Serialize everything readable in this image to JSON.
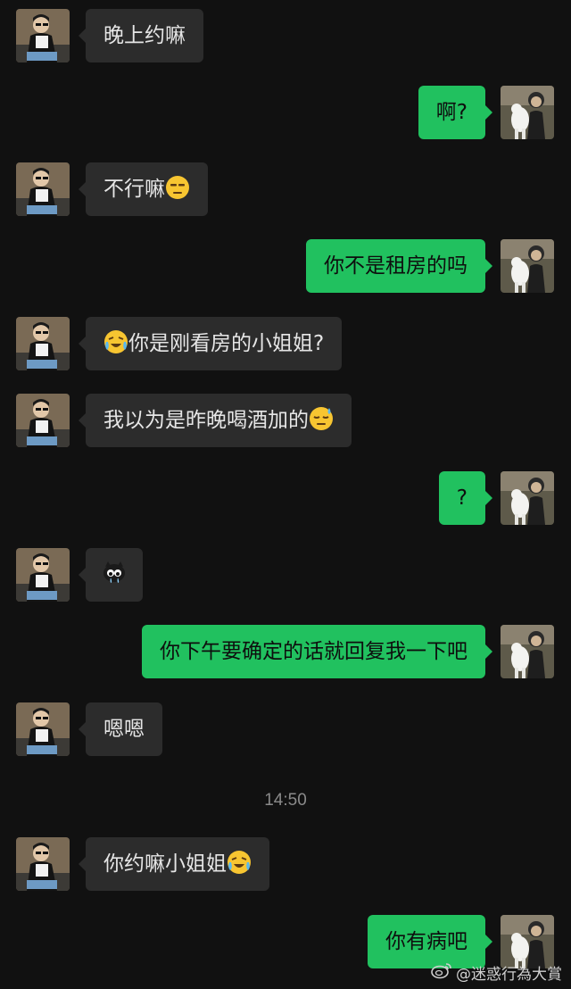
{
  "messages": [
    {
      "side": "left",
      "text": "晚上约嘛",
      "emoji": null
    },
    {
      "side": "right",
      "text": "啊?",
      "emoji": null
    },
    {
      "side": "left",
      "text": "不行嘛",
      "emoji": "unamused-face-emoji"
    },
    {
      "side": "right",
      "text": "你不是租房的吗",
      "emoji": null
    },
    {
      "side": "left",
      "text": "你是刚看房的小姐姐?",
      "emoji": "laughing-crying-face-emoji",
      "emoji_position": "before"
    },
    {
      "side": "left",
      "text": "我以为是昨晚喝酒加的",
      "emoji": "downcast-sweat-face-emoji"
    },
    {
      "side": "right",
      "text": "?",
      "emoji": null
    },
    {
      "side": "left",
      "text": "",
      "emoji": "crying-cartoon-sticker"
    },
    {
      "side": "right",
      "text": "你下午要确定的话就回复我一下吧",
      "emoji": null
    },
    {
      "side": "left",
      "text": "嗯嗯",
      "emoji": null
    },
    {
      "side": "left",
      "text": "你约嘛小姐姐",
      "emoji": "laughing-crying-face-emoji"
    },
    {
      "side": "right",
      "text": "你有病吧",
      "emoji": null
    }
  ],
  "timestamp": "14:50",
  "watermark": {
    "icon": "weibo-icon",
    "text": "@迷惑行為大賞"
  },
  "colors": {
    "background": "#111111",
    "incoming_bubble": "#2c2c2c",
    "outgoing_bubble": "#21c15f",
    "timestamp": "#8a8a8a"
  }
}
